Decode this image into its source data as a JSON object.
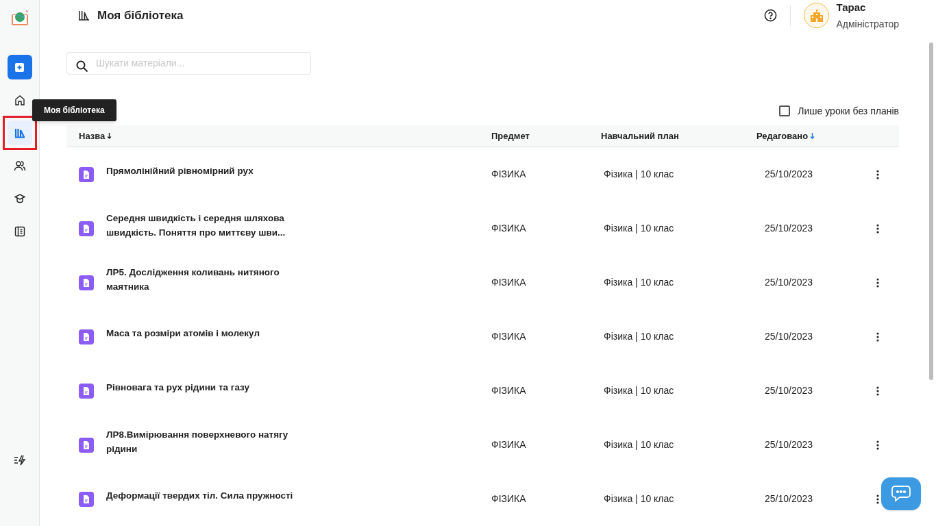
{
  "sidebar": {
    "items": [
      {
        "kind": "home",
        "selected": false,
        "highlighted": false
      },
      {
        "kind": "library",
        "selected": true,
        "highlighted": true
      },
      {
        "kind": "users",
        "selected": false,
        "highlighted": false
      },
      {
        "kind": "courses",
        "selected": false,
        "highlighted": false
      },
      {
        "kind": "notebook",
        "selected": false,
        "highlighted": false
      }
    ],
    "bottom_item": {
      "kind": "updates"
    },
    "tooltip": "Моя бібліотека"
  },
  "header": {
    "title": "Моя бібліотека",
    "user": {
      "name": "Тарас",
      "role": "Адміністратор"
    }
  },
  "search": {
    "placeholder": "Шукати матеріали..."
  },
  "filter": {
    "label": "Лише уроки без планів",
    "checked": false
  },
  "table": {
    "columns": [
      {
        "label": "Назва",
        "sort_active": false
      },
      {
        "label": "Предмет"
      },
      {
        "label": "Навчальний план"
      },
      {
        "label": "Редаговано",
        "sort_active": true
      }
    ],
    "rows": [
      {
        "title": "Прямолінійний рівномірний рух",
        "subject": "ФІЗИКА",
        "plan": "Фізика | 10 клас",
        "edited": "25/10/2023"
      },
      {
        "title": "Середня швидкість і середня шляхова швидкість. Поняття про миттєву шви...",
        "subject": "ФІЗИКА",
        "plan": "Фізика | 10 клас",
        "edited": "25/10/2023"
      },
      {
        "title": "ЛР5. Дослідження коливань нитяного маятника",
        "subject": "ФІЗИКА",
        "plan": "Фізика | 10 клас",
        "edited": "25/10/2023"
      },
      {
        "title": "Маса та розміри атомів і молекул",
        "subject": "ФІЗИКА",
        "plan": "Фізика | 10 клас",
        "edited": "25/10/2023"
      },
      {
        "title": "Рівновага та рух рідини та газу",
        "subject": "ФІЗИКА",
        "plan": "Фізика | 10 клас",
        "edited": "25/10/2023"
      },
      {
        "title": "ЛР8.Вимірювання поверхневого натягу рідини",
        "subject": "ФІЗИКА",
        "plan": "Фізика | 10 клас",
        "edited": "25/10/2023"
      },
      {
        "title": "Деформації твердих тіл. Сила пружності",
        "subject": "ФІЗИКА",
        "plan": "Фізика | 10 клас",
        "edited": "25/10/2023"
      }
    ]
  }
}
